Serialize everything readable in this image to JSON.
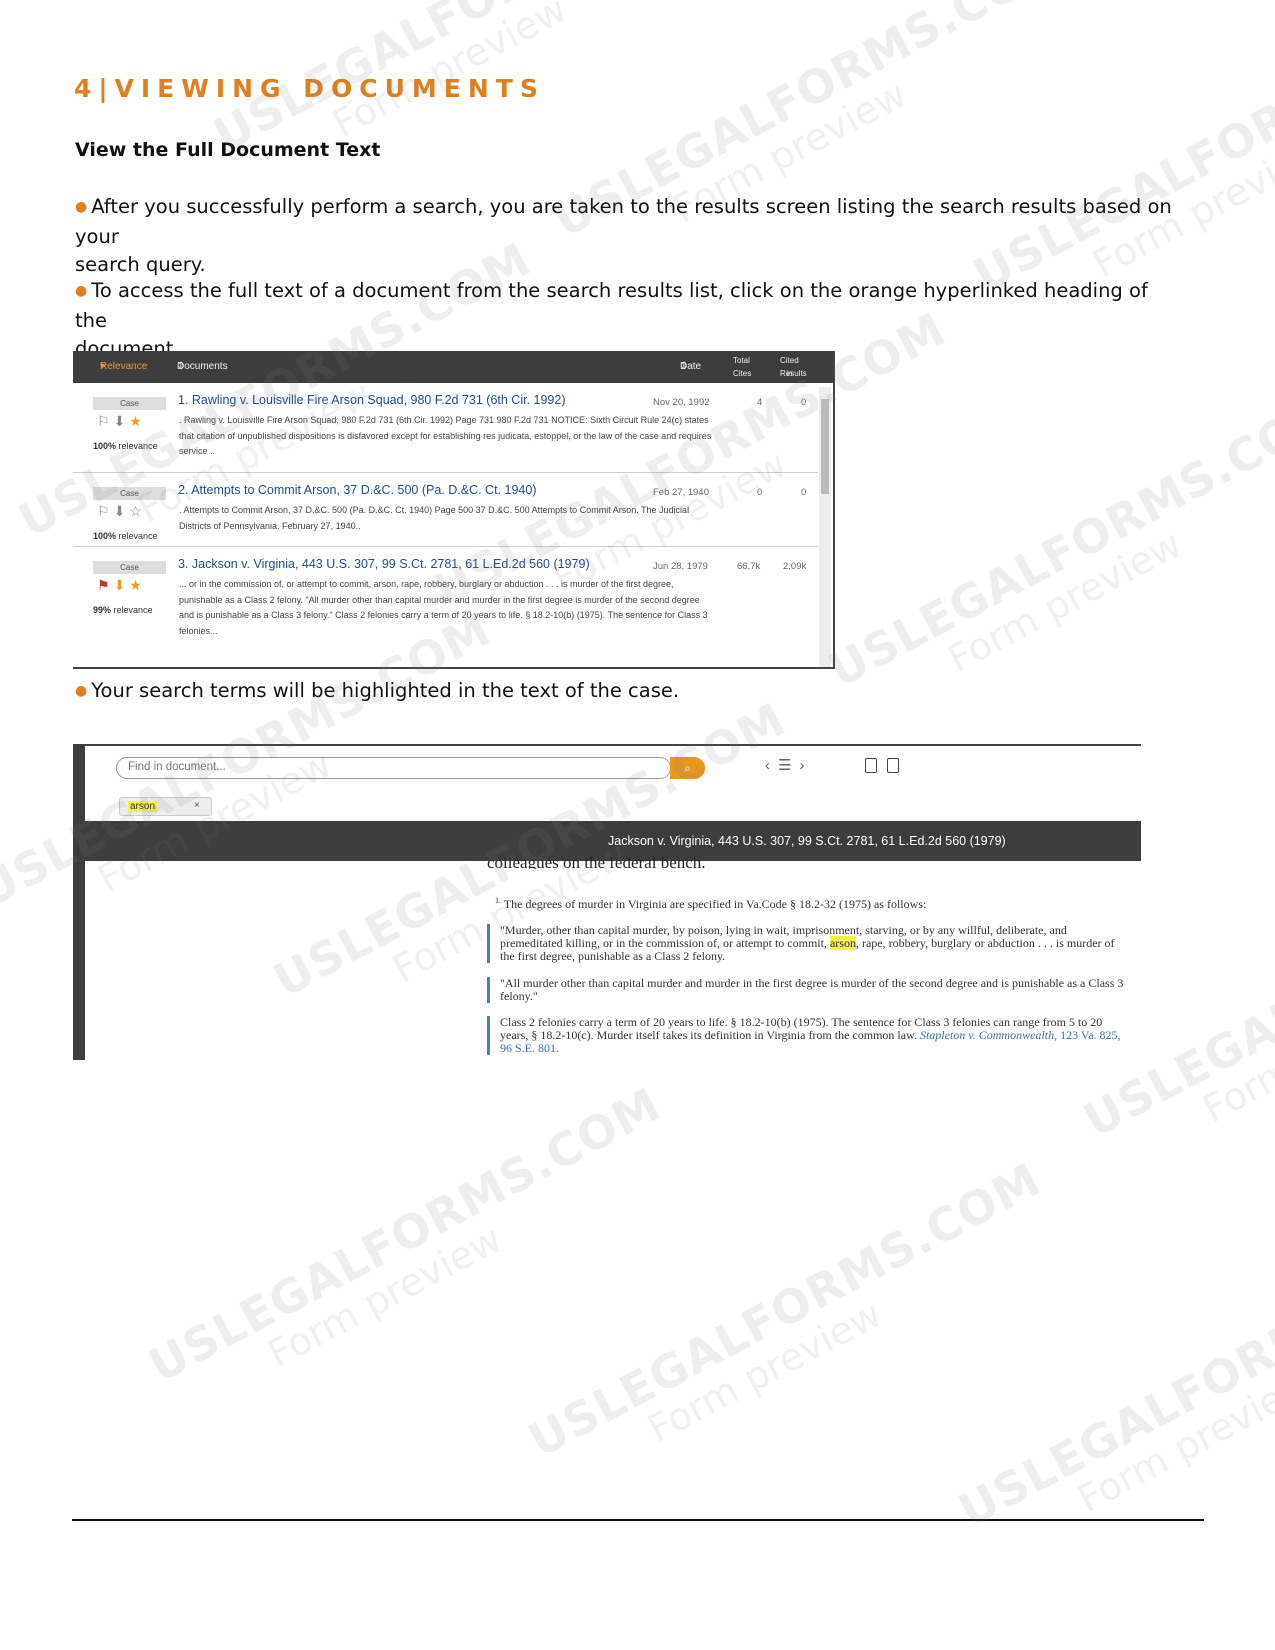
{
  "heading": "4|VIEWING DOCUMENTS",
  "subheading": "View the Full Document Text",
  "bullets": [
    {
      "l1": "After you successfully perform a search, you are taken to the results screen listing the search results based on your",
      "l2": "search query."
    },
    {
      "l1": "To access the full text of a document from the search results list, click on the orange hyperlinked heading of the",
      "l2": "document."
    },
    {
      "l1": "Your search terms will be highlighted in the text of the case."
    }
  ],
  "results": {
    "header": {
      "relevance": "Relevance",
      "documents": "Documents",
      "date": "Date",
      "total_cites_1": "Total",
      "total_cites_2": "Cites",
      "cited_1": "Cited in",
      "cited_2": "Results"
    },
    "rows": [
      {
        "badge": "Case",
        "relevance": "100%",
        "relevance_word": "relevance",
        "title": "1. Rawling v. Louisville Fire Arson Squad, 980 F.2d 731 (6th Cir. 1992)",
        "snippet": ". Rawling v. Louisville Fire Arson Squad, 980 F.2d 731 (6th Cir. 1992) Page 731 980 F.2d 731 NOTICE: Sixth Circuit Rule 24(c) states that citation of unpublished dispositions is disfavored except for establishing res judicata, estoppel, or the law of the case and requires service ..",
        "date": "Nov 20, 1992",
        "total_cites": "4",
        "cited": "0"
      },
      {
        "badge": "Case",
        "relevance": "100%",
        "relevance_word": "relevance",
        "title": "2. Attempts to Commit Arson, 37 D.&C. 500 (Pa. D.&C. Ct. 1940)",
        "snippet": ". Attempts to Commit Arson, 37 D.&C. 500 (Pa. D.&C. Ct. 1940) Page 500 37 D.&C. 500 Attempts to Commit Arson. The Judicial Districts of Pennsylvania. February 27, 1940..",
        "date": "Feb 27, 1940",
        "total_cites": "0",
        "cited": "0"
      },
      {
        "badge": "Case",
        "relevance": "99%",
        "relevance_word": "relevance",
        "title": "3. Jackson v. Virginia, 443 U.S. 307, 99 S.Ct. 2781, 61 L.Ed.2d 560 (1979)",
        "snippet": "... or in the commission of, or attempt to commit, arson, rape, robbery, burglary or abduction . . . is murder of the first degree, punishable as a Class 2 felony. \"All murder other than capital murder and murder in the first degree is murder of the second degree and is punishable as a Class 3 felony.\" Class 2 felonies carry a term of 20 years to life. § 18.2-10(b) (1975). The sentence for Class 3 felonies...",
        "date": "Jun 28, 1979",
        "total_cites": "66.7k",
        "cited": "2.09k"
      }
    ]
  },
  "viewer": {
    "find_placeholder": "Find in document...",
    "chip_term": "arson",
    "chip_close": "×",
    "doc_title": "Jackson v. Virginia, 443 U.S. 307, 99 S.Ct. 2781, 61 L.Ed.2d 560 (1979)",
    "cut_line": "colleagues on the federal bench.",
    "footnote_num": "1.",
    "footnote_text": "The degrees of murder in Virginia are specified in Va.Code § 18.2-32 (1975) as follows:",
    "q1_a": "\"Murder, other than capital murder, by poison, lying in wait, imprisonment, starving, or by any willful, deliberate, and premeditated killing, or in the commission of, or attempt to commit, ",
    "q1_hl": "arson",
    "q1_b": ", rape, robbery, burglary or abduction . . . is murder of the first degree, punishable as a Class 2 felony.",
    "q2": "\"All murder other than capital murder and murder in the first degree is murder of the second degree and is punishable as a Class 3 felony.\"",
    "q3": "Class 2 felonies carry a term of 20 years to life. § 18.2-10(b) (1975). The sentence for Class 3 felonies can range from 5 to 20 years, § 18.2-10(c). Murder itself takes its definition in Virginia from the common law.",
    "q3_cite": "Stapleton v. Commonwealth,",
    "q3_cite2": "123 Va. 825, 96 S.E. 801."
  },
  "watermark": {
    "main": "USLEGALFORMS.COM",
    "sub": "Form preview"
  },
  "colors": {
    "accent": "#e07f1f",
    "link": "#1f4d8a",
    "highlight": "#f3f04a",
    "dark_bar": "#3d3d3d"
  }
}
